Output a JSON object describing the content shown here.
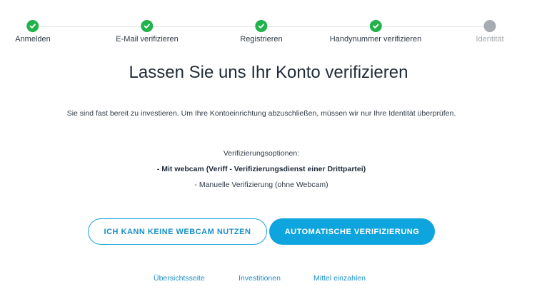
{
  "steps": [
    {
      "label": "Anmelden",
      "status": "done"
    },
    {
      "label": "E-Mail verifizieren",
      "status": "done"
    },
    {
      "label": "Registrieren",
      "status": "done"
    },
    {
      "label": "Handynummer verifizieren",
      "status": "done"
    },
    {
      "label": "Identität",
      "status": "pending"
    }
  ],
  "main": {
    "title": "Lassen Sie uns Ihr Konto verifizieren",
    "subtitle": "Sie sind fast bereit zu investieren. Um Ihre Kontoeinrichtung abzuschließen, müssen wir nur Ihre Identität überprüfen.",
    "options_heading": "Verifizierungsoptionen:",
    "option_webcam": "- Mit webcam (Veriff - Verifizierungsdienst einer Drittpartei)",
    "option_manual": "- Manuelle Verifizierung (ohne Webcam)"
  },
  "buttons": {
    "no_webcam": "ICH KANN KEINE WEBCAM NUTZEN",
    "auto_verify": "AUTOMATISCHE VERIFIZIERUNG"
  },
  "footer": {
    "overview": "Übersichtsseite",
    "investments": "Investitionen",
    "deposit": "Mittel einzahlen"
  },
  "colors": {
    "done": "#21b24b",
    "pending": "#a7abb2",
    "accent": "#0ea4dd"
  }
}
